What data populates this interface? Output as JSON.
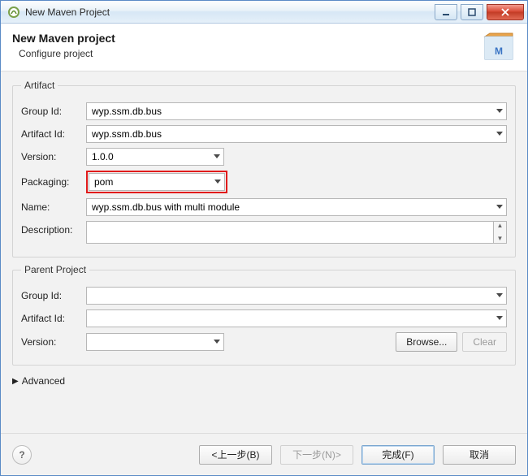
{
  "window": {
    "title": "New Maven Project"
  },
  "header": {
    "title": "New Maven project",
    "subtitle": "Configure project"
  },
  "artifact": {
    "legend": "Artifact",
    "labels": {
      "groupId": "Group Id:",
      "artifactId": "Artifact Id:",
      "version": "Version:",
      "packaging": "Packaging:",
      "name": "Name:",
      "description": "Description:"
    },
    "values": {
      "groupId": "wyp.ssm.db.bus",
      "artifactId": "wyp.ssm.db.bus",
      "version": "1.0.0",
      "packaging": "pom",
      "name": "wyp.ssm.db.bus with multi module",
      "description": ""
    }
  },
  "parent": {
    "legend": "Parent Project",
    "labels": {
      "groupId": "Group Id:",
      "artifactId": "Artifact Id:",
      "version": "Version:"
    },
    "values": {
      "groupId": "",
      "artifactId": "",
      "version": ""
    },
    "browse": "Browse...",
    "clear": "Clear"
  },
  "advanced": {
    "label": "Advanced"
  },
  "footer": {
    "back": "<上一步(B)",
    "next": "下一步(N)>",
    "finish": "完成(F)",
    "cancel": "取消"
  }
}
